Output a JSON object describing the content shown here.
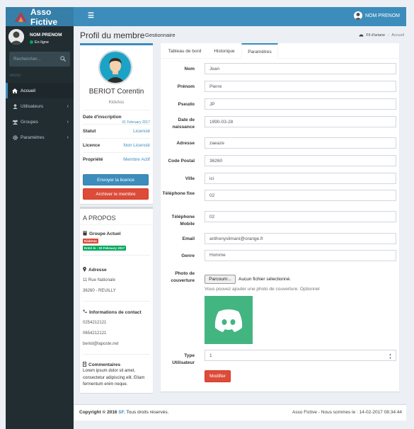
{
  "app": {
    "title": "Asso Fictive"
  },
  "topbar": {
    "menu_icon": "☰",
    "user_name": "NOM PRENOM"
  },
  "sidebar": {
    "user_name": "NOM PRENOM",
    "status": "En ligne",
    "search_placeholder": "Rechercher...",
    "menu_header": "MENU",
    "items": [
      {
        "label": "Accueil",
        "icon": "home-icon",
        "active": true
      },
      {
        "label": "Utilisateurs",
        "icon": "user-icon",
        "chevron": "‹"
      },
      {
        "label": "Groupes",
        "icon": "users-icon",
        "chevron": "‹"
      },
      {
        "label": "Paramètres",
        "icon": "gear-icon",
        "chevron": "‹"
      }
    ]
  },
  "header": {
    "title": "Profil du membre",
    "subtitle": "Gestionnaire",
    "breadcrumb": [
      "Fil d'ariane",
      "Accueil"
    ]
  },
  "profile": {
    "full_name": "BERIOT Corentin",
    "nickname": "KickAss",
    "rows": [
      {
        "key": "Date d'inscription",
        "value": "01 February 2017"
      },
      {
        "key": "Statut",
        "value": "Licencié"
      },
      {
        "key": "Licence",
        "value": "Non Licencié"
      },
      {
        "key": "Propriété",
        "value": "Membre Actif"
      }
    ],
    "send_button": "Envoyer la licence",
    "archive_button": "Archiver le membre"
  },
  "about": {
    "title": "A PROPOS",
    "group_heading": "Groupe Actuel",
    "group_label": "KickAss",
    "group_date": "Entré le : 03 February 2017",
    "address_heading": "Adresse",
    "address_line1": "11 Rue Nationale",
    "address_line2": "36260 - REUILLY",
    "contact_heading": "Informations de contact",
    "phone1": "0254212121",
    "phone2": "0654212121",
    "email": "beriot@laposte.net",
    "comments_heading": "Commentaires",
    "comments_text": "Lorem ipsum dolor sit amet, consectetur adipiscing elit. Etiam fermentum enim neque."
  },
  "tabs": [
    {
      "label": "Tableau de bord"
    },
    {
      "label": "Historique"
    },
    {
      "label": "Paramètres",
      "active": true
    }
  ],
  "form": {
    "nom": {
      "label": "Nom",
      "value": "Jean"
    },
    "prenom": {
      "label": "Prénom",
      "value": "Pierre"
    },
    "pseudo": {
      "label": "Pseudo",
      "value": "JP"
    },
    "naissance": {
      "label": "Date de naissance",
      "value": "1990-03-28"
    },
    "adresse": {
      "label": "Adresse",
      "value": "zaeaze"
    },
    "cp": {
      "label": "Code Postal",
      "value": "36260"
    },
    "ville": {
      "label": "Ville",
      "value": "ici"
    },
    "tel_fixe": {
      "label": "Téléphone fixe",
      "value": "02"
    },
    "tel_mobile": {
      "label": "Téléphone Mobile",
      "value": "02"
    },
    "email": {
      "label": "Email",
      "value": "anthonyslimani@orange.fr"
    },
    "genre": {
      "label": "Genre",
      "value": "Homme"
    },
    "photo": {
      "label": "Photo de couverture",
      "button": "Parcourir...",
      "status": "Aucun fichier sélectionné.",
      "help": "Vous pouvez ajouter une photo de couverture. Optionnel"
    },
    "type": {
      "label": "Type Utilisateur",
      "value": "1"
    },
    "submit": "Modifier"
  },
  "footer": {
    "copyright": "Copyright © 2016",
    "brand": "SF.",
    "rights": "Tous droits réservés.",
    "right_text": "Asso Fictive - Nous sommes le : 14-02-2017 08:34:44"
  },
  "colors": {
    "primary": "#3c8dbc",
    "danger": "#dd4b39",
    "success": "#00a65a",
    "sidebar": "#222d32",
    "cover": "#43b581"
  }
}
